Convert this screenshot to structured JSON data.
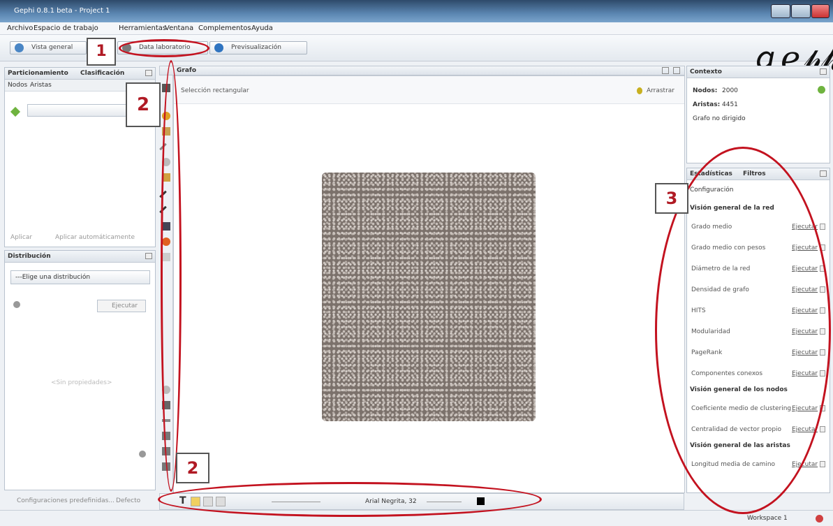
{
  "window": {
    "title": "Gephi 0.8.1 beta - Project 1"
  },
  "menu": [
    "Archivo",
    "Espacio de trabajo",
    "Herramientas",
    "Ventana",
    "Complementos",
    "Ayuda"
  ],
  "toolbar": {
    "overview": "Vista general",
    "data_lab": "Data laboratorio",
    "preview": "Previsualización"
  },
  "logo": "Gephi",
  "left_panel": {
    "tab1": "Particionamiento",
    "tab2": "Clasificación",
    "subtab_nodes": "Nodos",
    "subtab_edges": "Aristas",
    "apply": "Aplicar",
    "auto_apply": "Aplicar automáticamente"
  },
  "distribution": {
    "title": "Distribución",
    "dropdown": "---Elige una distribución",
    "run": "Ejecutar",
    "no_params": "<Sin propiedades>"
  },
  "left_footer": {
    "config": "Configuraciones predefinidas...",
    "default": "Defecto"
  },
  "graph": {
    "tab": "Grafo",
    "select_label": "Selección rectangular",
    "zoom_label": "Arrastrar"
  },
  "context": {
    "title": "Contexto",
    "nodes_label": "Nodos:",
    "nodes_value": "2000",
    "edges_label": "Aristas:",
    "edges_value": "4451",
    "type": "Grafo no dirigido"
  },
  "stats": {
    "tab1": "Estadísticas",
    "tab2": "Filtros",
    "config": "Configuración",
    "sections": [
      {
        "title": "Visión general de la red",
        "items": [
          "Grado medio",
          "Grado medio con pesos",
          "Diámetro de la red",
          "Densidad de grafo",
          "HITS",
          "Modularidad",
          "PageRank",
          "Componentes conexos"
        ]
      },
      {
        "title": "Visión general de los nodos",
        "items": [
          "Coeficiente medio de clustering",
          "Centralidad de vector propio"
        ]
      },
      {
        "title": "Visión general de las aristas",
        "items": [
          "Longitud media de camino"
        ]
      }
    ],
    "run": "Ejecutar"
  },
  "bottombar": {
    "font": "Arial Negrita, 32"
  },
  "statusbar": {
    "workspace": "Workspace 1"
  },
  "annotations": {
    "n1": "1",
    "n2a": "2",
    "n2b": "2",
    "n3": "3"
  },
  "colors": {
    "annotation": "#c3121f",
    "accent": "#4a86c5"
  }
}
